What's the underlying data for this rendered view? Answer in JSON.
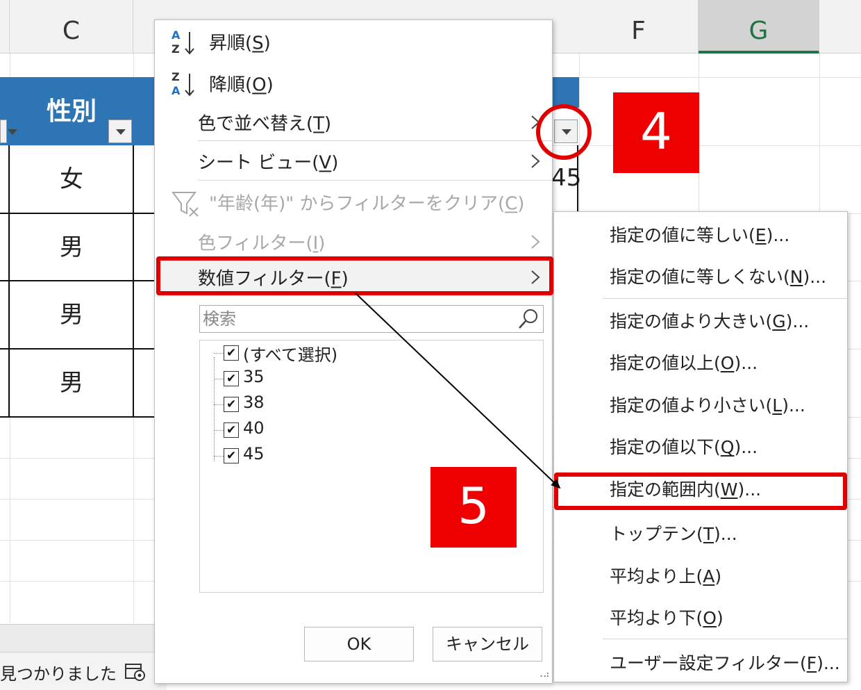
{
  "columns": {
    "c": "C",
    "f": "F",
    "g": "G"
  },
  "table": {
    "header": "性別",
    "rows": [
      "女",
      "男",
      "男",
      "男"
    ],
    "peek_value": "45"
  },
  "status": {
    "text": "見つかりました"
  },
  "filter_menu": {
    "sort_asc": {
      "prefix": "昇順(",
      "key": "S",
      "suffix": ")"
    },
    "sort_desc": {
      "prefix": "降順(",
      "key": "O",
      "suffix": ")"
    },
    "sort_by_color": {
      "prefix": "色で並べ替え(",
      "key": "T",
      "suffix": ")"
    },
    "sheet_view": {
      "prefix": "シート ビュー(",
      "key": "V",
      "suffix": ")"
    },
    "clear_filter": {
      "prefix": "\"年齢(年)\" からフィルターをクリア(",
      "key": "C",
      "suffix": ")"
    },
    "color_filter": {
      "prefix": "色フィルター(",
      "key": "I",
      "suffix": ")"
    },
    "number_filter": {
      "prefix": "数値フィルター(",
      "key": "F",
      "suffix": ")"
    },
    "search_placeholder": "検索",
    "checklist": [
      {
        "label": "(すべて選択)",
        "checked": true
      },
      {
        "label": "35",
        "checked": true
      },
      {
        "label": "38",
        "checked": true
      },
      {
        "label": "40",
        "checked": true
      },
      {
        "label": "45",
        "checked": true
      }
    ],
    "check_mark": "✔",
    "ok_label": "OK",
    "cancel_label": "キャンセル"
  },
  "number_filter_submenu": {
    "items": [
      {
        "prefix": "指定の値に等しい(",
        "key": "E",
        "suffix": ")..."
      },
      {
        "prefix": "指定の値に等しくない(",
        "key": "N",
        "suffix": ")..."
      },
      {
        "prefix": "指定の値より大きい(",
        "key": "G",
        "suffix": ")..."
      },
      {
        "prefix": "指定の値以上(",
        "key": "O",
        "suffix": ")..."
      },
      {
        "prefix": "指定の値より小さい(",
        "key": "L",
        "suffix": ")..."
      },
      {
        "prefix": "指定の値以下(",
        "key": "Q",
        "suffix": ")..."
      },
      {
        "prefix": "指定の範囲内(",
        "key": "W",
        "suffix": ")..."
      },
      {
        "prefix": "トップテン(",
        "key": "T",
        "suffix": ")..."
      },
      {
        "prefix": "平均より上(",
        "key": "A",
        "suffix": ")"
      },
      {
        "prefix": "平均より下(",
        "key": "O",
        "suffix": ")"
      },
      {
        "prefix": "ユーザー設定フィルター(",
        "key": "F",
        "suffix": ")..."
      }
    ]
  },
  "annotations": {
    "step4": "4",
    "step5": "5",
    "highlight_color": "#e00000"
  },
  "colors": {
    "table_header": "#2e75b6",
    "selected_column": "#217346"
  }
}
